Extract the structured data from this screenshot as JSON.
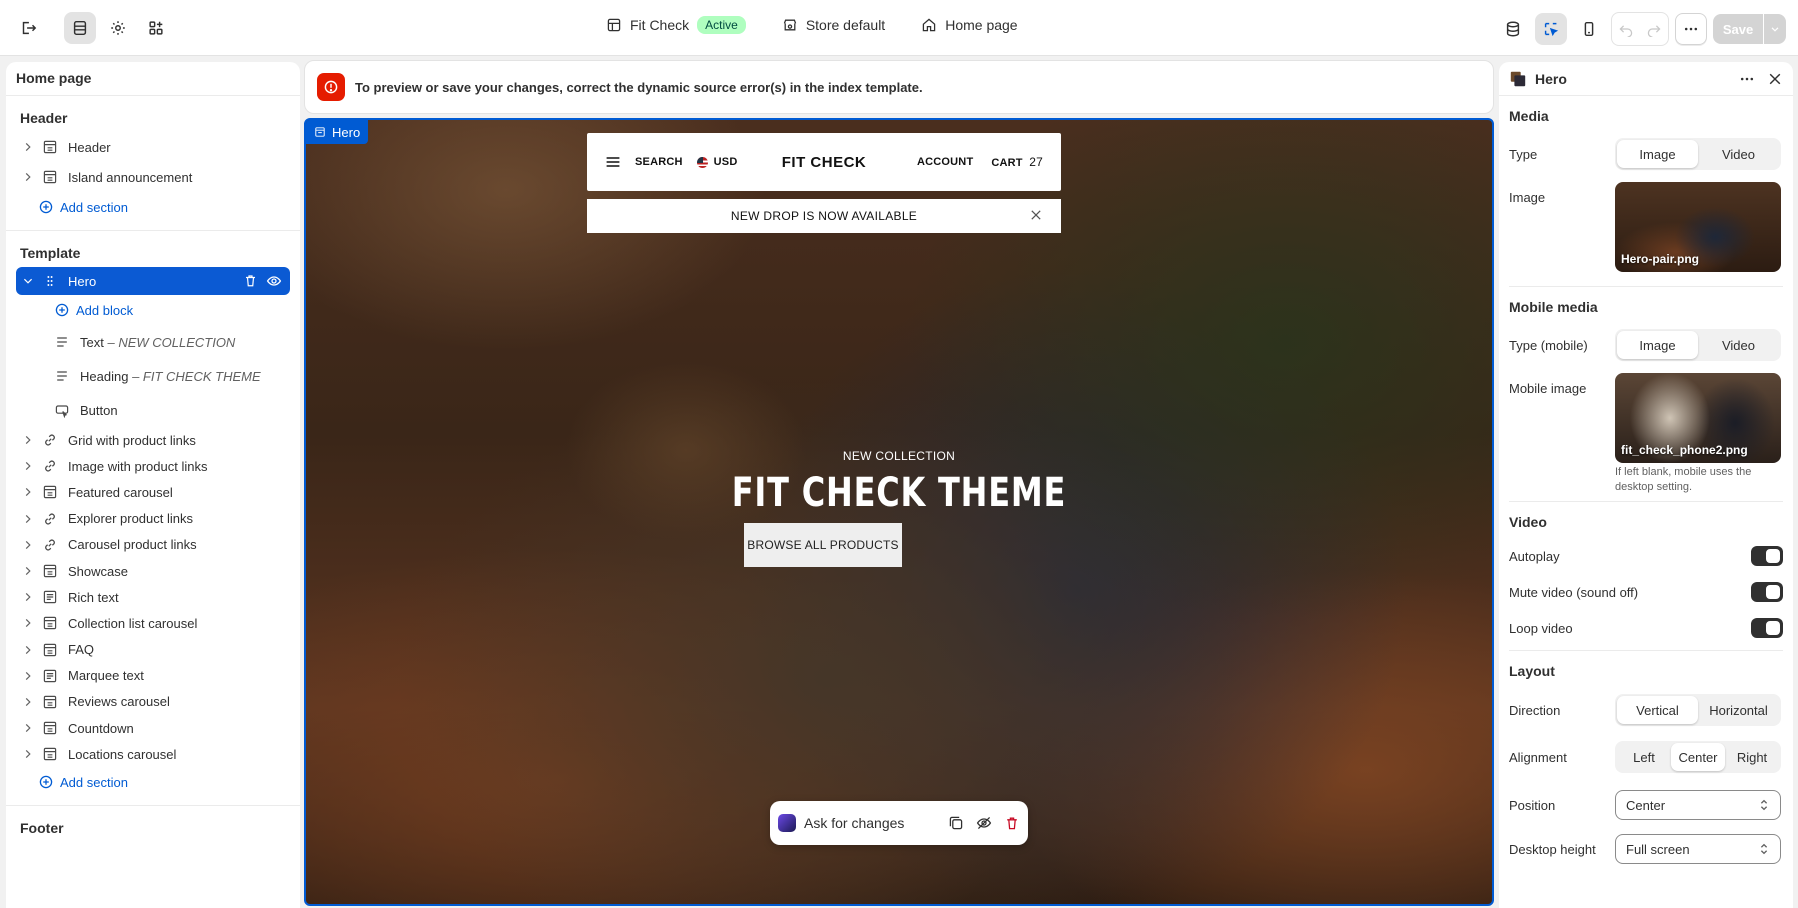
{
  "topbar": {
    "theme_name": "Fit Check",
    "theme_status": "Active",
    "store": "Store default",
    "page": "Home page",
    "save_label": "Save"
  },
  "left": {
    "title": "Home page",
    "header_group": "Header",
    "header_items": [
      "Header",
      "Island announcement"
    ],
    "add_section": "Add section",
    "template_group": "Template",
    "hero_item": "Hero",
    "add_block": "Add block",
    "blocks": [
      {
        "name": "Text",
        "detail": "NEW COLLECTION"
      },
      {
        "name": "Heading",
        "detail": "FIT CHECK THEME"
      },
      {
        "name": "Button",
        "detail": ""
      }
    ],
    "sections": [
      {
        "label": "Grid with product links",
        "icon": "link-icon"
      },
      {
        "label": "Image with product links",
        "icon": "link-icon"
      },
      {
        "label": "Featured carousel",
        "icon": "section-icon"
      },
      {
        "label": "Explorer product links",
        "icon": "link-icon"
      },
      {
        "label": "Carousel product links",
        "icon": "link-icon"
      },
      {
        "label": "Showcase",
        "icon": "section-icon"
      },
      {
        "label": "Rich text",
        "icon": "text-icon"
      },
      {
        "label": "Collection list carousel",
        "icon": "section-icon"
      },
      {
        "label": "FAQ",
        "icon": "section-icon"
      },
      {
        "label": "Marquee text",
        "icon": "text-icon"
      },
      {
        "label": "Reviews carousel",
        "icon": "section-icon"
      },
      {
        "label": "Countdown",
        "icon": "section-icon"
      },
      {
        "label": "Locations carousel",
        "icon": "section-icon"
      }
    ],
    "add_section_2": "Add section",
    "footer_group": "Footer"
  },
  "preview": {
    "error_text": "To preview or save your changes, correct the dynamic source error(s) in the index template.",
    "hero_tag": "Hero",
    "nav": {
      "search": "SEARCH",
      "currency": "USD",
      "brand": "FIT CHECK",
      "account": "ACCOUNT",
      "cart": "CART",
      "cart_count": "27"
    },
    "announcement": "NEW DROP IS NOW AVAILABLE",
    "subheading": "NEW COLLECTION",
    "heading": "FIT CHECK THEME",
    "button": "BROWSE ALL PRODUCTS",
    "ask": "Ask for changes"
  },
  "right": {
    "title": "Hero",
    "media_title": "Media",
    "type_label": "Type",
    "type_options": [
      "Image",
      "Video"
    ],
    "type_selected": "Image",
    "image_label": "Image",
    "image_file": "Hero-pair.png",
    "mobile_media_title": "Mobile media",
    "mobile_type_label": "Type (mobile)",
    "mobile_type_options": [
      "Image",
      "Video"
    ],
    "mobile_image_label": "Mobile image",
    "mobile_image_file": "fit_check_phone2.png",
    "mobile_hint": "If left blank, mobile uses the desktop setting.",
    "video_title": "Video",
    "autoplay": "Autoplay",
    "mute": "Mute video (sound off)",
    "loop": "Loop video",
    "layout_title": "Layout",
    "direction_label": "Direction",
    "direction_options": [
      "Vertical",
      "Horizontal"
    ],
    "alignment_label": "Alignment",
    "alignment_options": [
      "Left",
      "Center",
      "Right"
    ],
    "position_label": "Position",
    "position_value": "Center",
    "desktop_height_label": "Desktop height",
    "desktop_height_value": "Full screen"
  },
  "colors": {
    "accent": "#005bd3",
    "error": "#e51c00",
    "badge": "#affebf"
  }
}
